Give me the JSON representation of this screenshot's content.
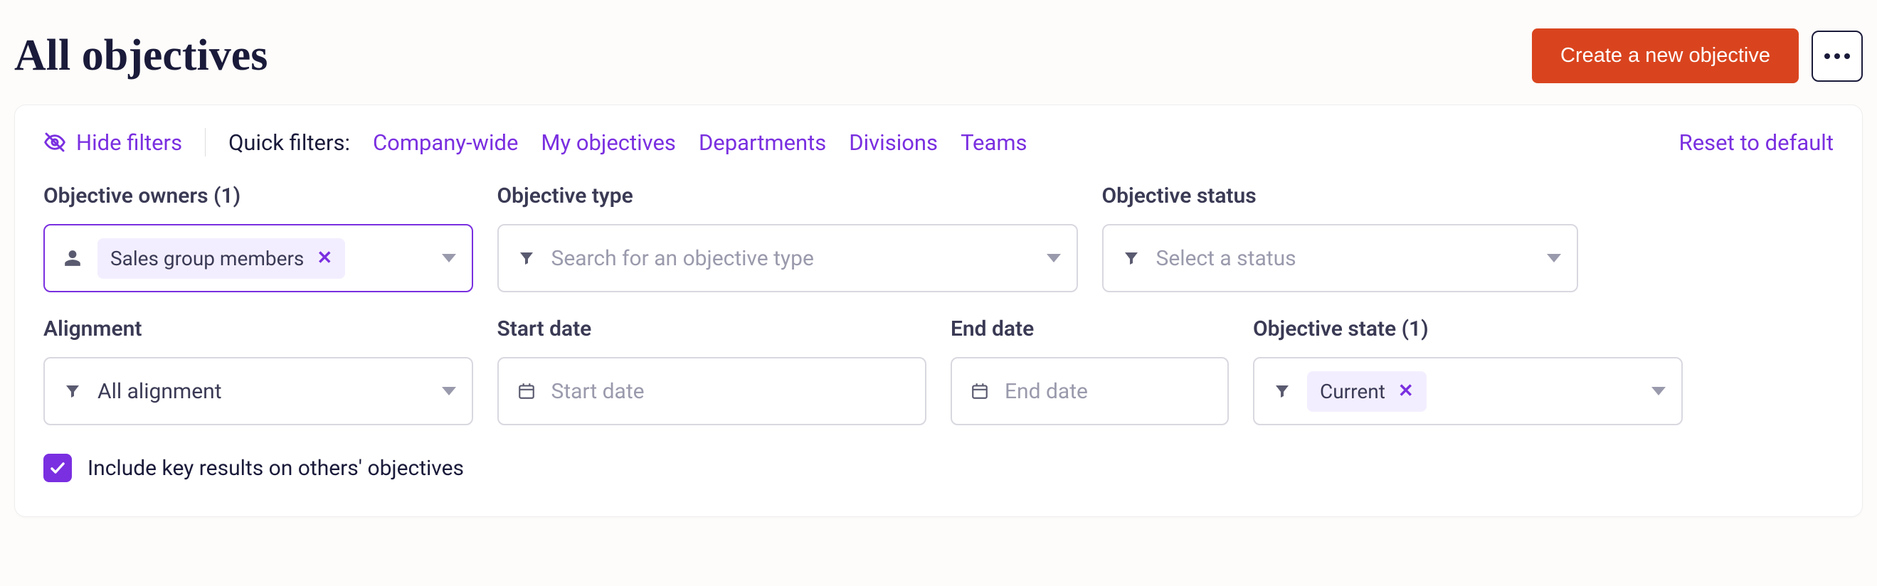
{
  "header": {
    "title": "All objectives",
    "create_label": "Create a new objective"
  },
  "filters": {
    "hide_label": "Hide filters",
    "quick_label": "Quick filters:",
    "quick_links": {
      "company": "Company-wide",
      "my": "My objectives",
      "departments": "Departments",
      "divisions": "Divisions",
      "teams": "Teams"
    },
    "reset_label": "Reset to default",
    "owners": {
      "label": "Objective owners (1)",
      "chip": "Sales group members"
    },
    "type": {
      "label": "Objective type",
      "placeholder": "Search for an objective type"
    },
    "status": {
      "label": "Objective status",
      "placeholder": "Select a status"
    },
    "alignment": {
      "label": "Alignment",
      "value": "All alignment"
    },
    "start": {
      "label": "Start date",
      "placeholder": "Start date"
    },
    "end": {
      "label": "End date",
      "placeholder": "End date"
    },
    "state": {
      "label": "Objective state (1)",
      "chip": "Current"
    },
    "include_kr_label": "Include key results on others' objectives"
  }
}
